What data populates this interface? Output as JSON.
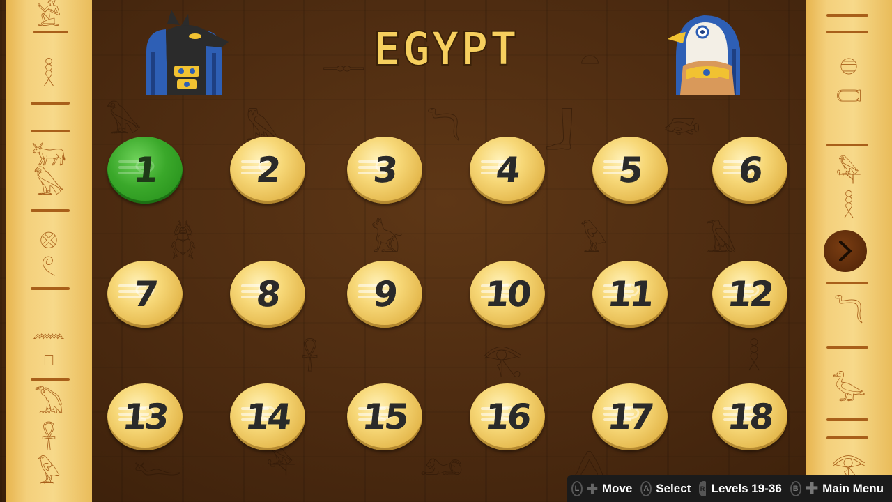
{
  "title": "EGYPT",
  "levels": [
    {
      "label": "1",
      "selected": true
    },
    {
      "label": "2",
      "selected": false
    },
    {
      "label": "3",
      "selected": false
    },
    {
      "label": "4",
      "selected": false
    },
    {
      "label": "5",
      "selected": false
    },
    {
      "label": "6",
      "selected": false
    },
    {
      "label": "7",
      "selected": false
    },
    {
      "label": "8",
      "selected": false
    },
    {
      "label": "9",
      "selected": false
    },
    {
      "label": "10",
      "selected": false
    },
    {
      "label": "11",
      "selected": false
    },
    {
      "label": "12",
      "selected": false
    },
    {
      "label": "13",
      "selected": false
    },
    {
      "label": "14",
      "selected": false
    },
    {
      "label": "15",
      "selected": false
    },
    {
      "label": "16",
      "selected": false
    },
    {
      "label": "17",
      "selected": false
    },
    {
      "label": "18",
      "selected": false
    }
  ],
  "next_page_icon": "chevron-right-icon",
  "controls": {
    "l_button": "L",
    "move_label": "Move",
    "a_button": "A",
    "select_label": "Select",
    "r_button": "R",
    "levels_label": "Levels 19-36",
    "b_button": "B",
    "menu_label": "Main Menu"
  },
  "colors": {
    "background": "#4b2a10",
    "pillar": "#f4d07c",
    "coin": "#f7d878",
    "selected_coin": "#3aa82a",
    "title": "#f6cf5e",
    "controls_bar": "#1b1b1b"
  }
}
